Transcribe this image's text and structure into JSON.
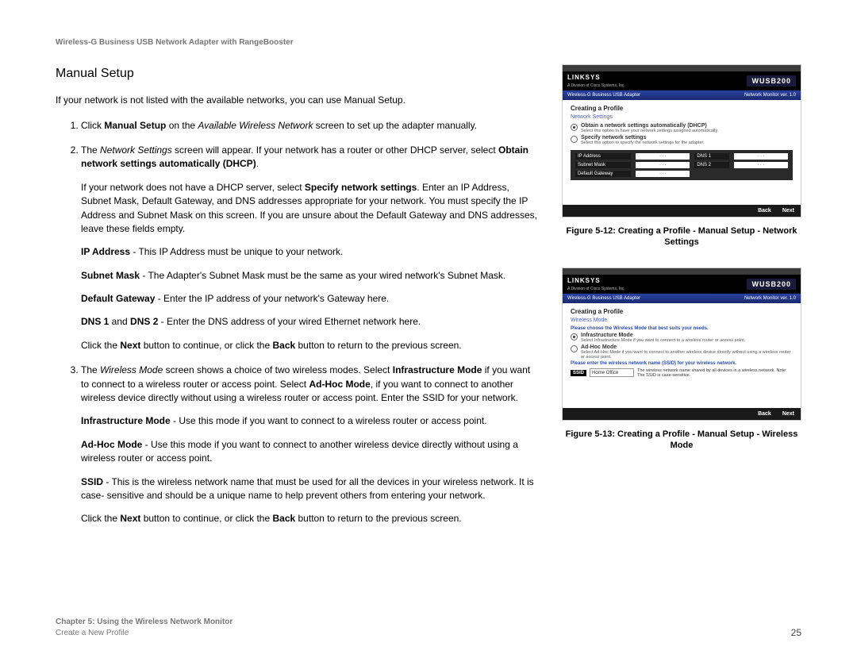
{
  "header": "Wireless-G Business USB Network Adapter with RangeBooster",
  "section_title": "Manual Setup",
  "intro": "If your network is not listed with the available networks, you can use Manual Setup.",
  "step1": {
    "pre": "Click ",
    "b1": "Manual Setup",
    "mid": " on the ",
    "i1": "Available Wireless Network",
    "post": " screen to set up the adapter manually."
  },
  "step2": {
    "p1_pre": "The ",
    "p1_i": "Network Settings",
    "p1_mid": " screen will appear. If your network has a router or other DHCP server, select ",
    "p1_b": "Obtain network settings automatically (DHCP)",
    "p1_post": ".",
    "p2_pre": "If your network does not have a DHCP server, select ",
    "p2_b": "Specify network settings",
    "p2_post": ". Enter an IP Address, Subnet Mask, Default Gateway, and DNS addresses appropriate for your network. You must specify the IP Address and Subnet Mask on this screen. If you are unsure about the Default Gateway and DNS addresses, leave these fields empty.",
    "ip_b": "IP Address",
    "ip_t": " - This IP Address must be unique to your network.",
    "sm_b": "Subnet Mask",
    "sm_t": " - The Adapter's Subnet Mask must be the same as your wired network's Subnet Mask.",
    "dg_b": "Default Gateway",
    "dg_t": " - Enter the IP address of your network's Gateway here.",
    "dns_b1": "DNS 1",
    "dns_mid": " and ",
    "dns_b2": "DNS 2",
    "dns_t": " - Enter the DNS address of your wired Ethernet network here.",
    "nav_pre": "Click the ",
    "nav_b1": "Next",
    "nav_mid": " button to continue, or click the ",
    "nav_b2": "Back",
    "nav_post": " button to return to the previous screen."
  },
  "step3": {
    "p1_pre": "The ",
    "p1_i": "Wireless Mode",
    "p1_mid": " screen shows a choice of two wireless modes. Select ",
    "p1_b1": "Infrastructure Mode",
    "p1_mid2": " if you want to connect to a wireless router or access point. Select ",
    "p1_b2": "Ad-Hoc Mode",
    "p1_post": ", if you want to connect to another wireless device directly without using a wireless router or access point. Enter the SSID for your network.",
    "im_b": "Infrastructure Mode",
    "im_t": " - Use this mode if you want to connect to a wireless router or access point.",
    "ah_b": "Ad-Hoc Mode",
    "ah_t": " - Use this mode if you want to connect to another wireless device directly without using a wireless router or access point.",
    "ss_b": "SSID",
    "ss_t": " - This is the wireless network name that must be used for all the devices in your wireless network. It is case- sensitive and should be a unique name to help prevent others from entering your network.",
    "nav_pre": "Click the ",
    "nav_b1": "Next",
    "nav_mid": " button to continue, or click the ",
    "nav_b2": "Back",
    "nav_post": " button to return to the previous screen."
  },
  "fig1": {
    "brand": "LINKSYS",
    "brand_sub": "A Division of Cisco Systems, Inc.",
    "model": "WUSB200",
    "bb_left": "Wireless-G Business USB Adapter",
    "bb_right": "Network Monitor  ver. 1.0",
    "cp": "Creating a Profile",
    "sub": "Network Settings",
    "opt1": "Obtain a network settings automatically (DHCP)",
    "opt1d": "Select this option to have your network settings assigned automatically.",
    "opt2": "Specify network settings",
    "opt2d": "Select this option to specify the network settings for the adapter.",
    "lbl_ip": "IP Address",
    "lbl_sm": "Subnet Mask",
    "lbl_dg": "Default Gateway",
    "lbl_d1": "DNS 1",
    "lbl_d2": "DNS 2",
    "dots": ".   .   .",
    "back": "Back",
    "next": "Next",
    "caption": "Figure 5-12: Creating a Profile - Manual Setup - Network Settings"
  },
  "fig2": {
    "brand": "LINKSYS",
    "brand_sub": "A Division of Cisco Systems, Inc.",
    "model": "WUSB200",
    "bb_left": "Wireless-G Business USB Adapter",
    "bb_right": "Network Monitor  ver. 1.0",
    "cp": "Creating a Profile",
    "sub": "Wireless Mode",
    "note1": "Please choose the Wireless Mode that best suits your needs.",
    "opt1": "Infrastructure Mode",
    "opt1d": "Select Infrastructure Mode if you want to connect to a wireless router or access point.",
    "opt2": "Ad-Hoc Mode",
    "opt2d": "Select Ad-Hoc Mode if you want to connect to another wireless device directly without using a wireless router or access point.",
    "note2": "Please enter the wireless network name (SSID) for your wireless network.",
    "ssid_lbl": "SSID",
    "ssid_val": "Home Office",
    "ssid_desc": "The wireless network name shared by all devices in a wireless network. Note: The SSID is case-sensitive.",
    "back": "Back",
    "next": "Next",
    "caption": "Figure 5-13: Creating a Profile - Manual Setup - Wireless Mode"
  },
  "footer": {
    "chapter": "Chapter 5: Using the Wireless Network Monitor",
    "sub": "Create a New Profile",
    "page": "25"
  }
}
